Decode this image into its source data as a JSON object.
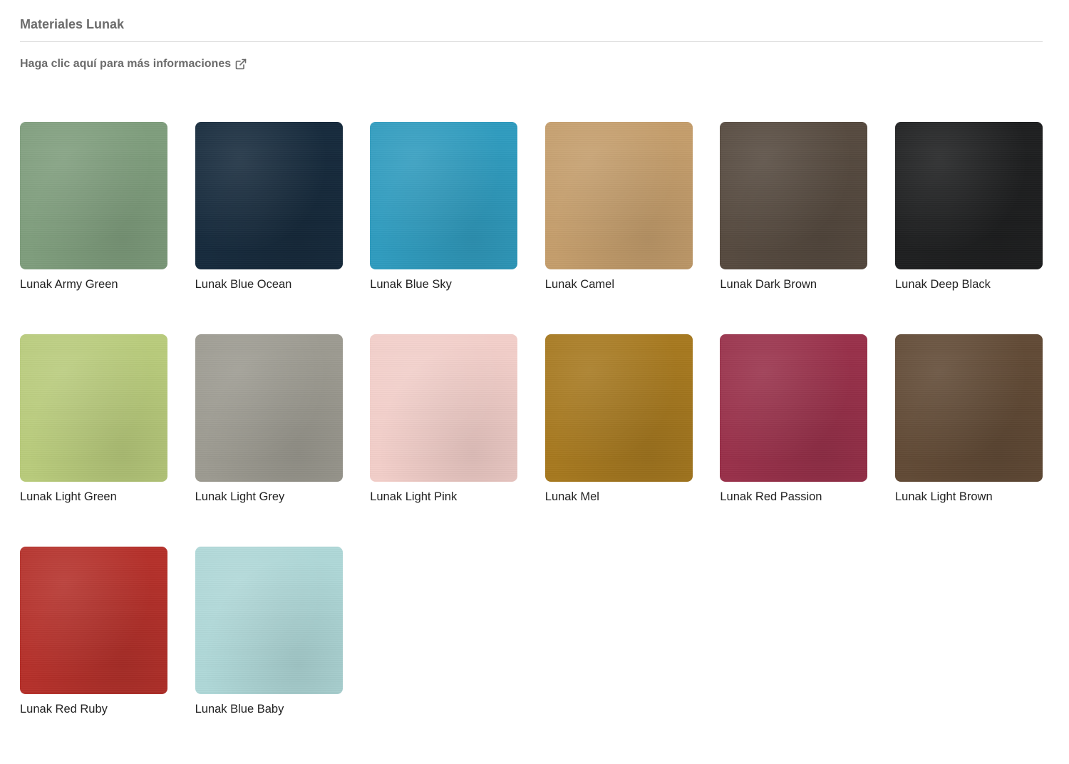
{
  "section": {
    "title": "Materiales Lunak",
    "info_link_label": "Haga clic aquí para más informaciones",
    "info_link_icon": "external-link-icon"
  },
  "materials": [
    {
      "name": "Lunak Army Green",
      "color": "#7f9e7d"
    },
    {
      "name": "Lunak Blue Ocean",
      "color": "#162a3c"
    },
    {
      "name": "Lunak Blue Sky",
      "color": "#2f9cbf"
    },
    {
      "name": "Lunak Camel",
      "color": "#c59e6c"
    },
    {
      "name": "Lunak Dark Brown",
      "color": "#564a3f"
    },
    {
      "name": "Lunak Deep Black",
      "color": "#1e1f20"
    },
    {
      "name": "Lunak Light Green",
      "color": "#b9cc7c"
    },
    {
      "name": "Lunak Light Grey",
      "color": "#9d9b91"
    },
    {
      "name": "Lunak Light Pink",
      "color": "#f3cfca"
    },
    {
      "name": "Lunak Mel",
      "color": "#a7791f"
    },
    {
      "name": "Lunak Red Passion",
      "color": "#99304a"
    },
    {
      "name": "Lunak Light Brown",
      "color": "#614a35"
    },
    {
      "name": "Lunak Red Ruby",
      "color": "#b5302a"
    },
    {
      "name": "Lunak Blue Baby",
      "color": "#afd8d8"
    }
  ]
}
